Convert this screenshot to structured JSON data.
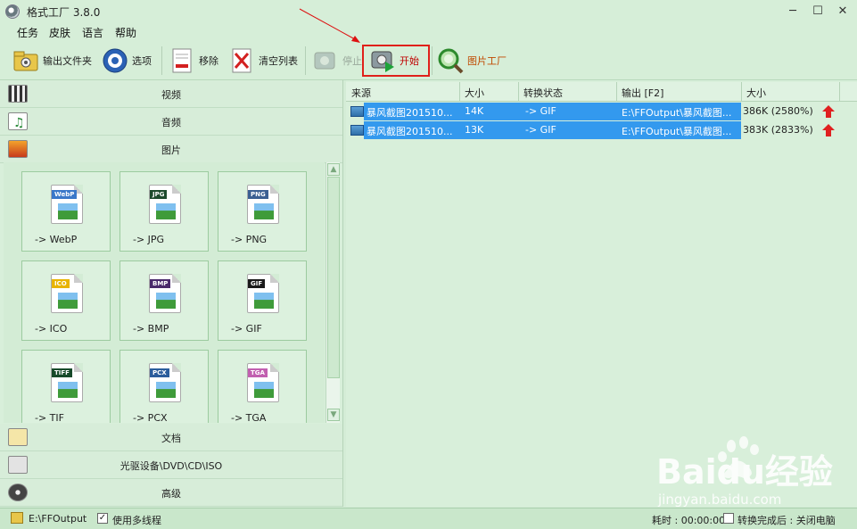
{
  "window": {
    "title": "格式工厂 3.8.0"
  },
  "menu": [
    "任务",
    "皮肤",
    "语言",
    "帮助"
  ],
  "toolbar": {
    "output_folder": "输出文件夹",
    "options": "选项",
    "remove": "移除",
    "clear_list": "清空列表",
    "stop": "停止",
    "start": "开始",
    "picture_factory": "图片工厂"
  },
  "categories": {
    "video": "视频",
    "audio": "音频",
    "picture": "图片",
    "document": "文档",
    "optical": "光驱设备\\DVD\\CD\\ISO",
    "advanced": "高级"
  },
  "formats": [
    {
      "label": "-> WebP",
      "badge": "WebP",
      "badge_color": "#3a78c9"
    },
    {
      "label": "-> JPG",
      "badge": "JPG",
      "badge_color": "#1d4a2c"
    },
    {
      "label": "-> PNG",
      "badge": "PNG",
      "badge_color": "#3b5f92"
    },
    {
      "label": "-> ICO",
      "badge": "ICO",
      "badge_color": "#e8b400"
    },
    {
      "label": "-> BMP",
      "badge": "BMP",
      "badge_color": "#4a2a6b"
    },
    {
      "label": "-> GIF",
      "badge": "GIF",
      "badge_color": "#1a1a1a"
    },
    {
      "label": "-> TIF",
      "badge": "TIFF",
      "badge_color": "#174a2a"
    },
    {
      "label": "-> PCX",
      "badge": "PCX",
      "badge_color": "#2b5d9c"
    },
    {
      "label": "-> TGA",
      "badge": "TGA",
      "badge_color": "#c25fb0"
    }
  ],
  "table": {
    "headers": [
      "来源",
      "大小",
      "转换状态",
      "输出 [F2]",
      "大小"
    ],
    "rows": [
      {
        "source": "暴风截图201510...",
        "size": "14K",
        "status": "-> GIF",
        "output": "E:\\FFOutput\\暴风截图...",
        "result": "386K  (2580%)"
      },
      {
        "source": "暴风截图201510...",
        "size": "13K",
        "status": "-> GIF",
        "output": "E:\\FFOutput\\暴风截图...",
        "result": "383K  (2833%)"
      }
    ]
  },
  "status": {
    "output_path": "E:\\FFOutput",
    "multithread": "使用多线程",
    "elapsed": "耗时 : 00:00:00",
    "after_done": "转换完成后 : 关闭电脑"
  },
  "watermark": {
    "brand": "Baidu经验",
    "url": "jingyan.baidu.com"
  },
  "colors": {
    "selection": "#3399ee",
    "highlight_box": "#e0201a",
    "arrow": "#dd1111",
    "background": "#d4ecd6"
  }
}
